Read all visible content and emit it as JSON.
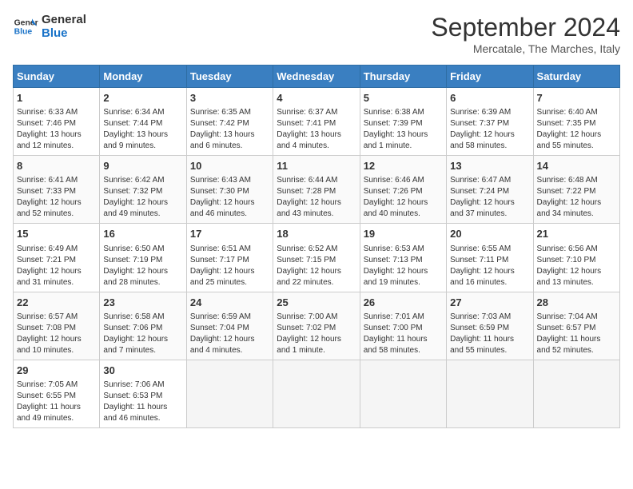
{
  "header": {
    "logo_line1": "General",
    "logo_line2": "Blue",
    "month": "September 2024",
    "location": "Mercatale, The Marches, Italy"
  },
  "weekdays": [
    "Sunday",
    "Monday",
    "Tuesday",
    "Wednesday",
    "Thursday",
    "Friday",
    "Saturday"
  ],
  "weeks": [
    [
      {
        "day": "1",
        "info": "Sunrise: 6:33 AM\nSunset: 7:46 PM\nDaylight: 13 hours\nand 12 minutes."
      },
      {
        "day": "2",
        "info": "Sunrise: 6:34 AM\nSunset: 7:44 PM\nDaylight: 13 hours\nand 9 minutes."
      },
      {
        "day": "3",
        "info": "Sunrise: 6:35 AM\nSunset: 7:42 PM\nDaylight: 13 hours\nand 6 minutes."
      },
      {
        "day": "4",
        "info": "Sunrise: 6:37 AM\nSunset: 7:41 PM\nDaylight: 13 hours\nand 4 minutes."
      },
      {
        "day": "5",
        "info": "Sunrise: 6:38 AM\nSunset: 7:39 PM\nDaylight: 13 hours\nand 1 minute."
      },
      {
        "day": "6",
        "info": "Sunrise: 6:39 AM\nSunset: 7:37 PM\nDaylight: 12 hours\nand 58 minutes."
      },
      {
        "day": "7",
        "info": "Sunrise: 6:40 AM\nSunset: 7:35 PM\nDaylight: 12 hours\nand 55 minutes."
      }
    ],
    [
      {
        "day": "8",
        "info": "Sunrise: 6:41 AM\nSunset: 7:33 PM\nDaylight: 12 hours\nand 52 minutes."
      },
      {
        "day": "9",
        "info": "Sunrise: 6:42 AM\nSunset: 7:32 PM\nDaylight: 12 hours\nand 49 minutes."
      },
      {
        "day": "10",
        "info": "Sunrise: 6:43 AM\nSunset: 7:30 PM\nDaylight: 12 hours\nand 46 minutes."
      },
      {
        "day": "11",
        "info": "Sunrise: 6:44 AM\nSunset: 7:28 PM\nDaylight: 12 hours\nand 43 minutes."
      },
      {
        "day": "12",
        "info": "Sunrise: 6:46 AM\nSunset: 7:26 PM\nDaylight: 12 hours\nand 40 minutes."
      },
      {
        "day": "13",
        "info": "Sunrise: 6:47 AM\nSunset: 7:24 PM\nDaylight: 12 hours\nand 37 minutes."
      },
      {
        "day": "14",
        "info": "Sunrise: 6:48 AM\nSunset: 7:22 PM\nDaylight: 12 hours\nand 34 minutes."
      }
    ],
    [
      {
        "day": "15",
        "info": "Sunrise: 6:49 AM\nSunset: 7:21 PM\nDaylight: 12 hours\nand 31 minutes."
      },
      {
        "day": "16",
        "info": "Sunrise: 6:50 AM\nSunset: 7:19 PM\nDaylight: 12 hours\nand 28 minutes."
      },
      {
        "day": "17",
        "info": "Sunrise: 6:51 AM\nSunset: 7:17 PM\nDaylight: 12 hours\nand 25 minutes."
      },
      {
        "day": "18",
        "info": "Sunrise: 6:52 AM\nSunset: 7:15 PM\nDaylight: 12 hours\nand 22 minutes."
      },
      {
        "day": "19",
        "info": "Sunrise: 6:53 AM\nSunset: 7:13 PM\nDaylight: 12 hours\nand 19 minutes."
      },
      {
        "day": "20",
        "info": "Sunrise: 6:55 AM\nSunset: 7:11 PM\nDaylight: 12 hours\nand 16 minutes."
      },
      {
        "day": "21",
        "info": "Sunrise: 6:56 AM\nSunset: 7:10 PM\nDaylight: 12 hours\nand 13 minutes."
      }
    ],
    [
      {
        "day": "22",
        "info": "Sunrise: 6:57 AM\nSunset: 7:08 PM\nDaylight: 12 hours\nand 10 minutes."
      },
      {
        "day": "23",
        "info": "Sunrise: 6:58 AM\nSunset: 7:06 PM\nDaylight: 12 hours\nand 7 minutes."
      },
      {
        "day": "24",
        "info": "Sunrise: 6:59 AM\nSunset: 7:04 PM\nDaylight: 12 hours\nand 4 minutes."
      },
      {
        "day": "25",
        "info": "Sunrise: 7:00 AM\nSunset: 7:02 PM\nDaylight: 12 hours\nand 1 minute."
      },
      {
        "day": "26",
        "info": "Sunrise: 7:01 AM\nSunset: 7:00 PM\nDaylight: 11 hours\nand 58 minutes."
      },
      {
        "day": "27",
        "info": "Sunrise: 7:03 AM\nSunset: 6:59 PM\nDaylight: 11 hours\nand 55 minutes."
      },
      {
        "day": "28",
        "info": "Sunrise: 7:04 AM\nSunset: 6:57 PM\nDaylight: 11 hours\nand 52 minutes."
      }
    ],
    [
      {
        "day": "29",
        "info": "Sunrise: 7:05 AM\nSunset: 6:55 PM\nDaylight: 11 hours\nand 49 minutes."
      },
      {
        "day": "30",
        "info": "Sunrise: 7:06 AM\nSunset: 6:53 PM\nDaylight: 11 hours\nand 46 minutes."
      },
      {
        "day": "",
        "info": ""
      },
      {
        "day": "",
        "info": ""
      },
      {
        "day": "",
        "info": ""
      },
      {
        "day": "",
        "info": ""
      },
      {
        "day": "",
        "info": ""
      }
    ]
  ]
}
